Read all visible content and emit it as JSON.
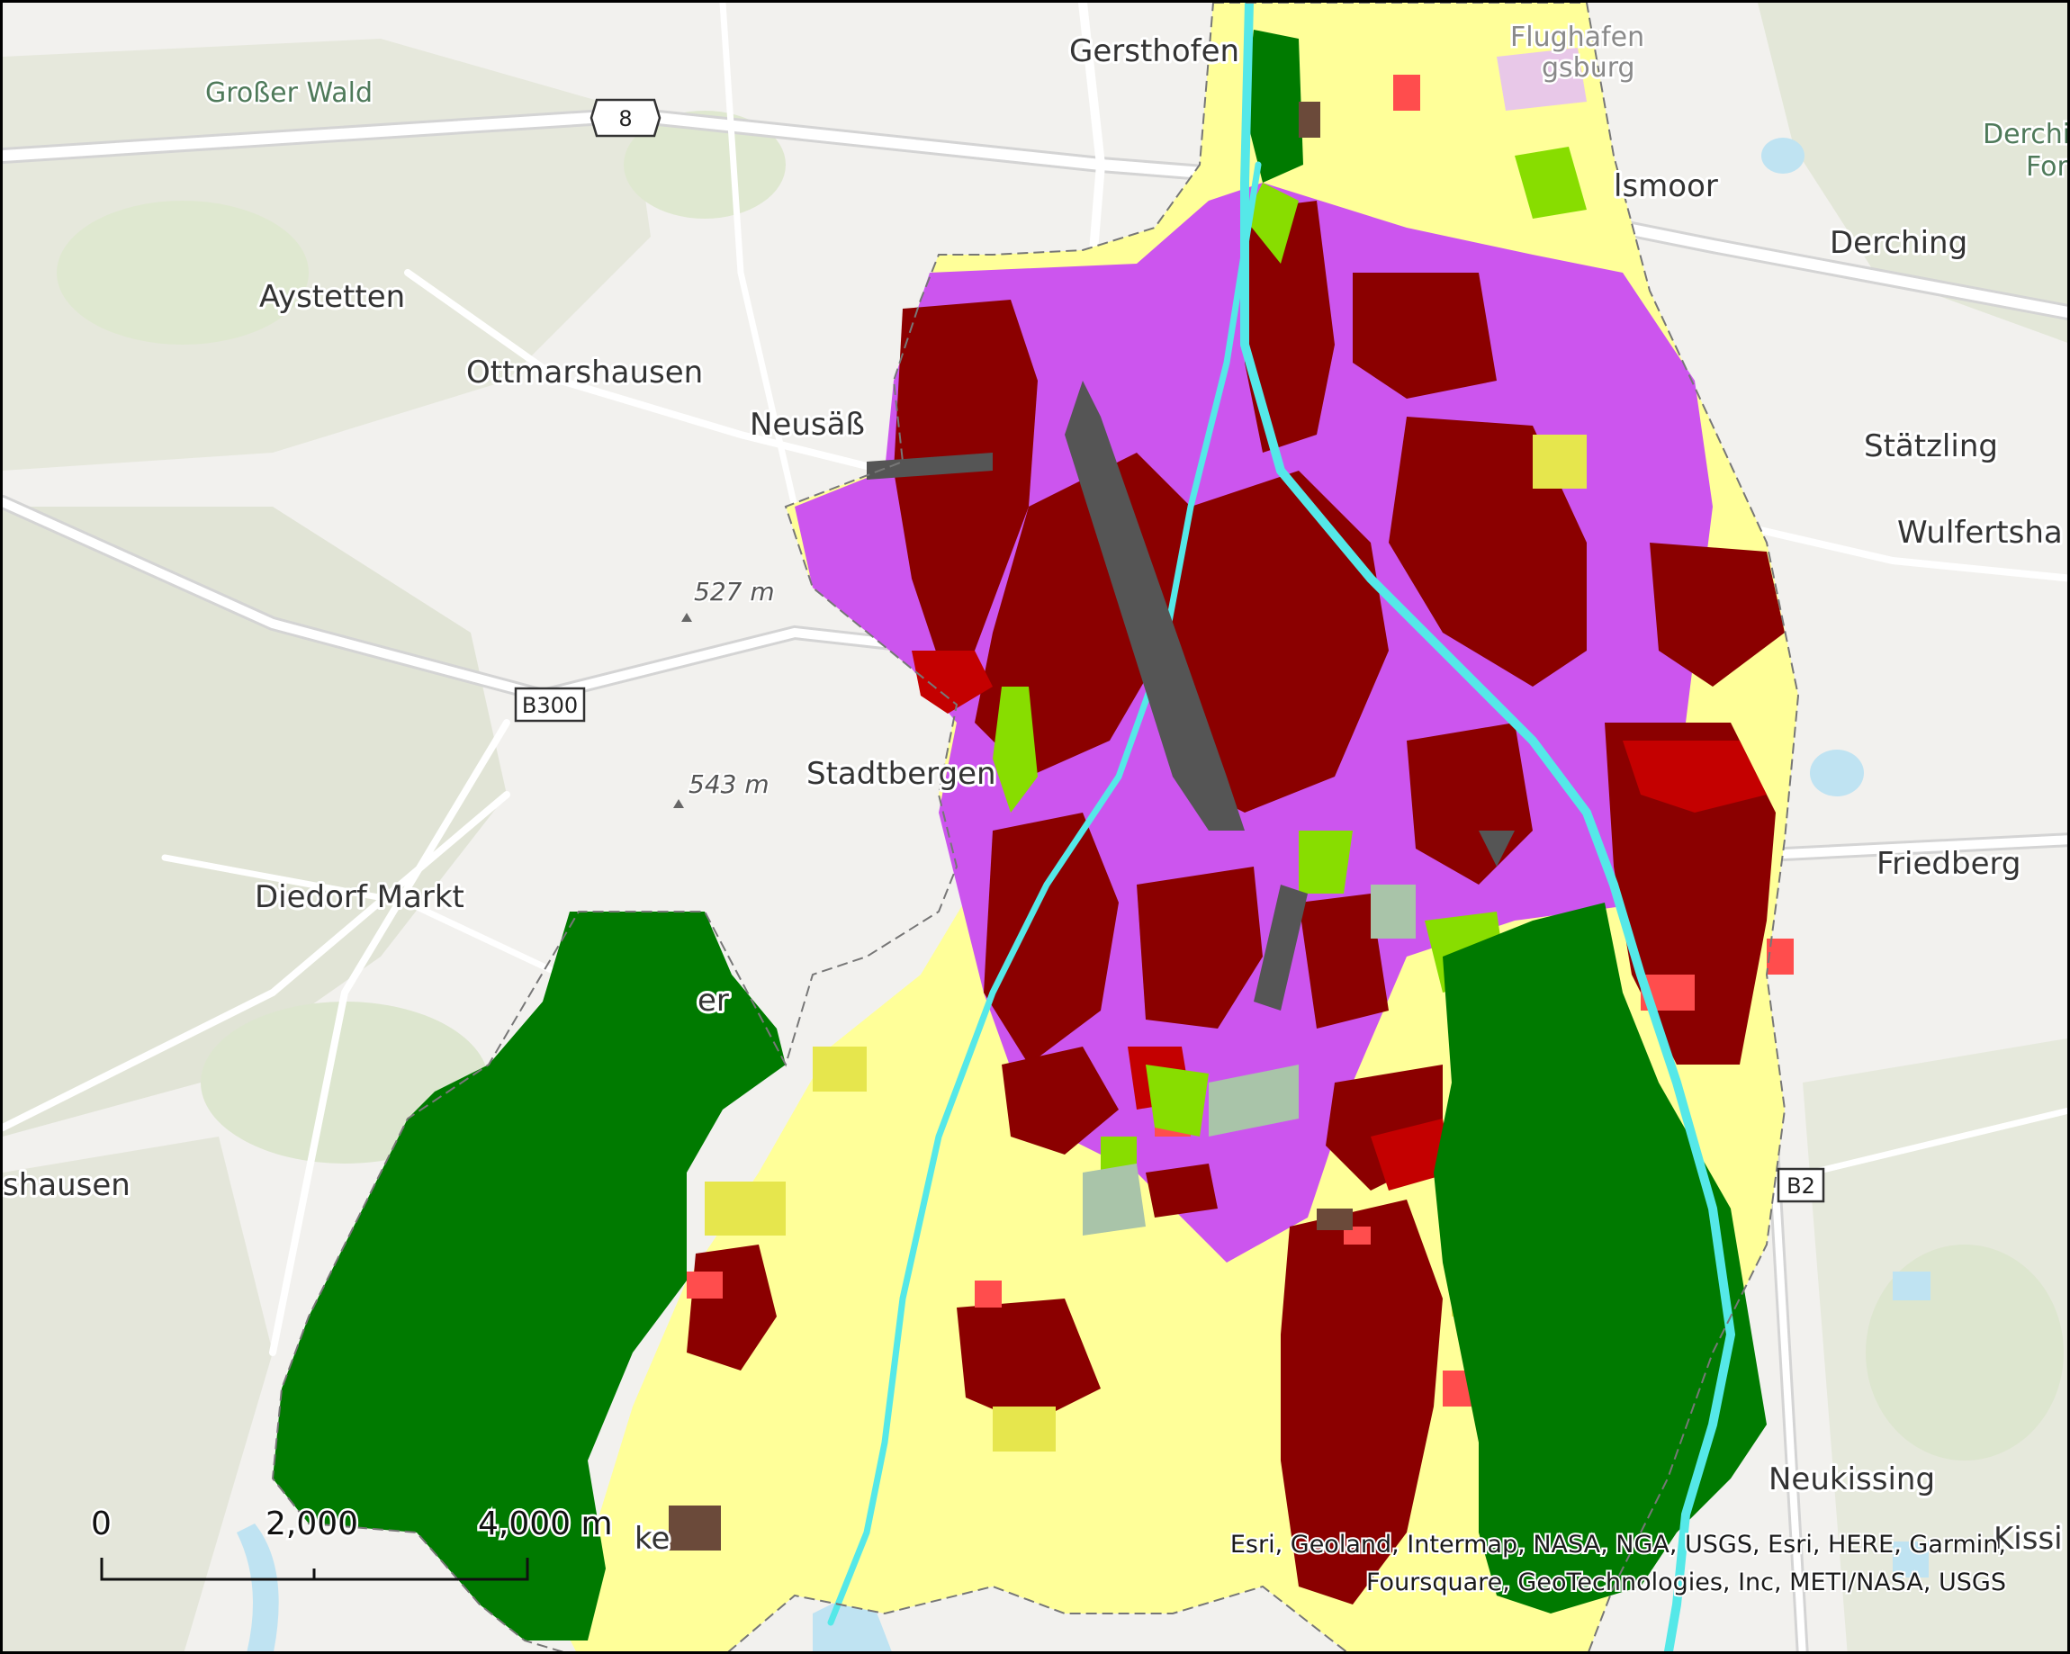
{
  "basemap": {
    "colors": {
      "background": "#f2f1ee",
      "forest": "#dde6cf",
      "road": "#ffffff",
      "road_casing": "#d9d9d9",
      "water": "#bfe3f2",
      "hillshade": "#e4e4e0"
    }
  },
  "place_labels": {
    "gersthofen": "Gersthofen",
    "flughafen_line1": "Flughafen",
    "flughafen_line2": "gsburg",
    "grosser_wald": "Großer Wald",
    "derching_forst_1": "Derchi",
    "derching_forst_2": "Fors",
    "aystetten": "Aystetten",
    "ottmarshausen": "Ottmarshausen",
    "neusass": "Neusäß",
    "lsmoor": "lsmoor",
    "derching": "Derching",
    "staetzling": "Stätzling",
    "wulfertshausen": "Wulfertsha",
    "stadtbergen": "Stadtbergen",
    "diedorf": "Diedorf Markt",
    "friedberg": "Friedberg",
    "hausen": "shausen",
    "neukissing": "Neukissing",
    "kissing": "Kissi",
    "partial_er": "er",
    "partial_ke": "ke"
  },
  "elevations": {
    "e527": "527 m",
    "e543": "543 m"
  },
  "road_shields": {
    "r8": "8",
    "b300": "B300",
    "b2": "B2"
  },
  "scale_bar": {
    "label_0": "0",
    "label_2000": "2,000",
    "label_4000": "4,000 m"
  },
  "attribution": {
    "line1": "Esri, Geoland, Intermap, NASA, NGA, USGS, Esri, HERE, Garmin,",
    "line2": "Foursquare, GeoTechnologies, Inc, METI/NASA, USGS"
  },
  "land_use_colors": {
    "residential_dense": "#8b0000",
    "residential": "#c40000",
    "residential_light": "#ff4d4d",
    "commercial_industrial": "#cc55ee",
    "urban_green": "#88dd00",
    "forest": "#007a00",
    "agriculture": "#ffff99",
    "pasture": "#e6e64d",
    "transport": "#555555",
    "water": "#55e8e8",
    "other_grey": "#a9c4a9",
    "airport": "#e8c8e8",
    "bare": "#6b4a3a"
  }
}
